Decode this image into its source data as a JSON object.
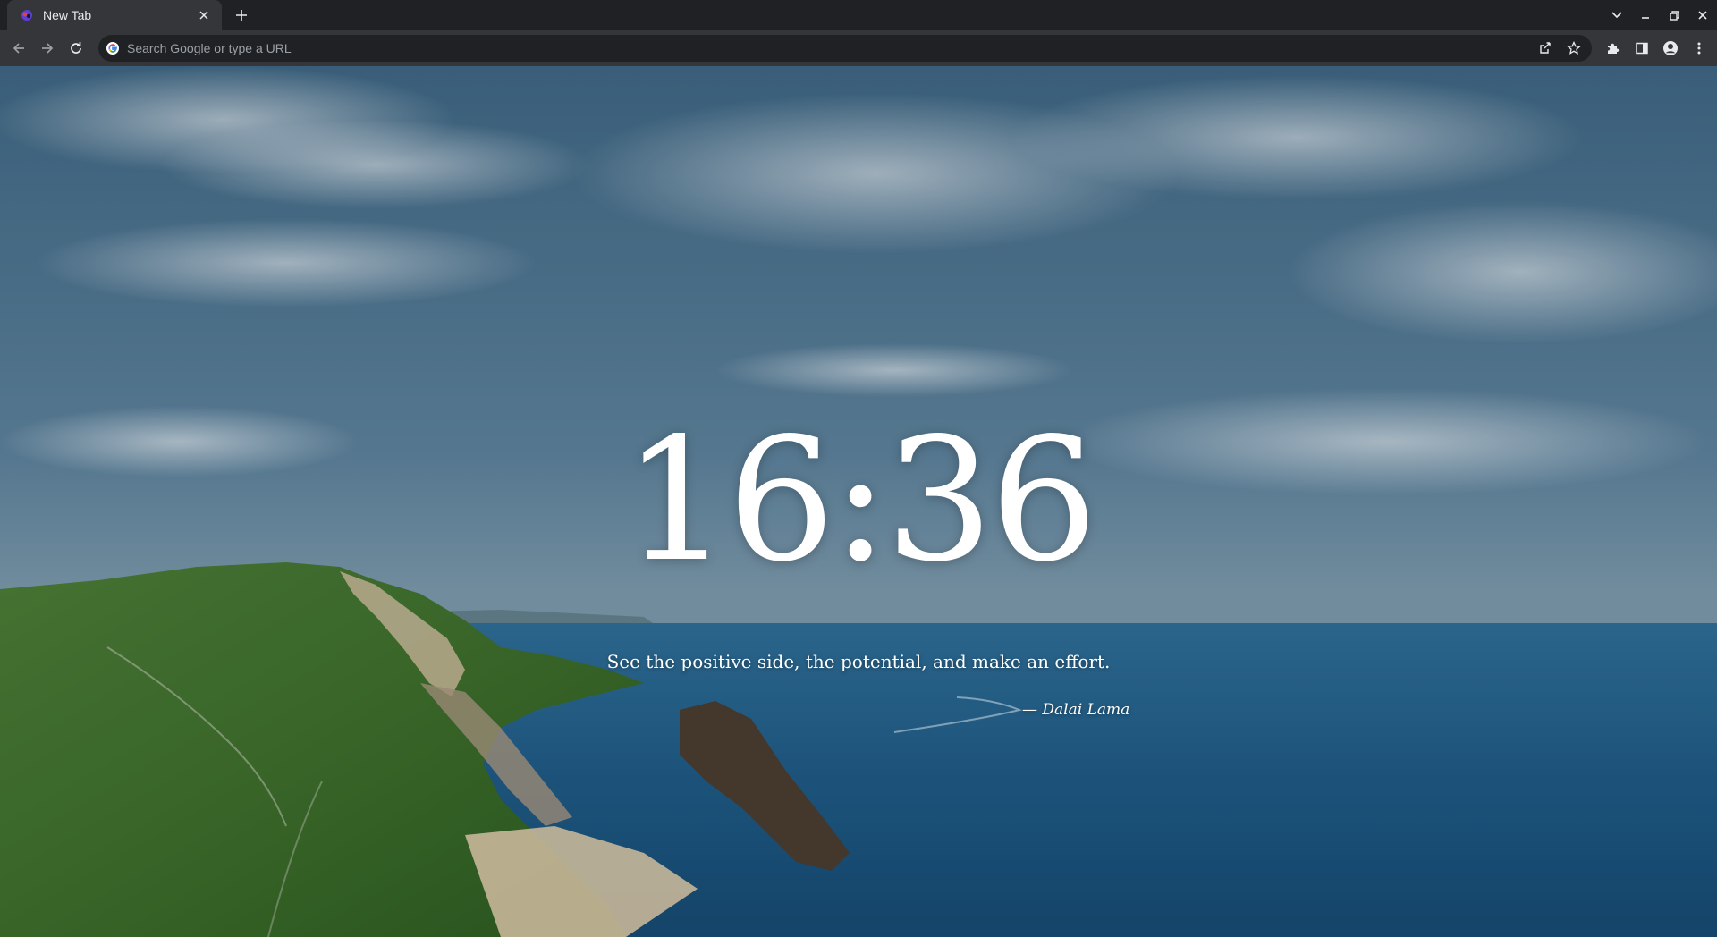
{
  "browser": {
    "tab": {
      "title": "New Tab",
      "favicon": "new-tab-favicon"
    },
    "omnibox": {
      "placeholder": "Search Google or type a URL",
      "value": ""
    },
    "icons": {
      "back": "arrow-left-icon",
      "forward": "arrow-right-icon",
      "reload": "reload-icon",
      "share": "share-icon",
      "bookmark": "star-icon",
      "extensions": "puzzle-icon",
      "side_panel": "side-panel-icon",
      "profile": "person-icon",
      "menu": "kebab-menu-icon",
      "tab_search": "chevron-down-icon",
      "minimize": "minimize-icon",
      "restore": "restore-icon",
      "close": "close-icon"
    }
  },
  "page": {
    "clock": "16:36",
    "quote": "See the positive side, the potential, and make an effort.",
    "author": "— Dalai Lama",
    "colors": {
      "sky_top": "#4f7895",
      "sky_bottom": "#6f8fa5",
      "sea": "#1f5a85",
      "land": "#3d6a2e",
      "cliff": "#c9b89a"
    }
  }
}
